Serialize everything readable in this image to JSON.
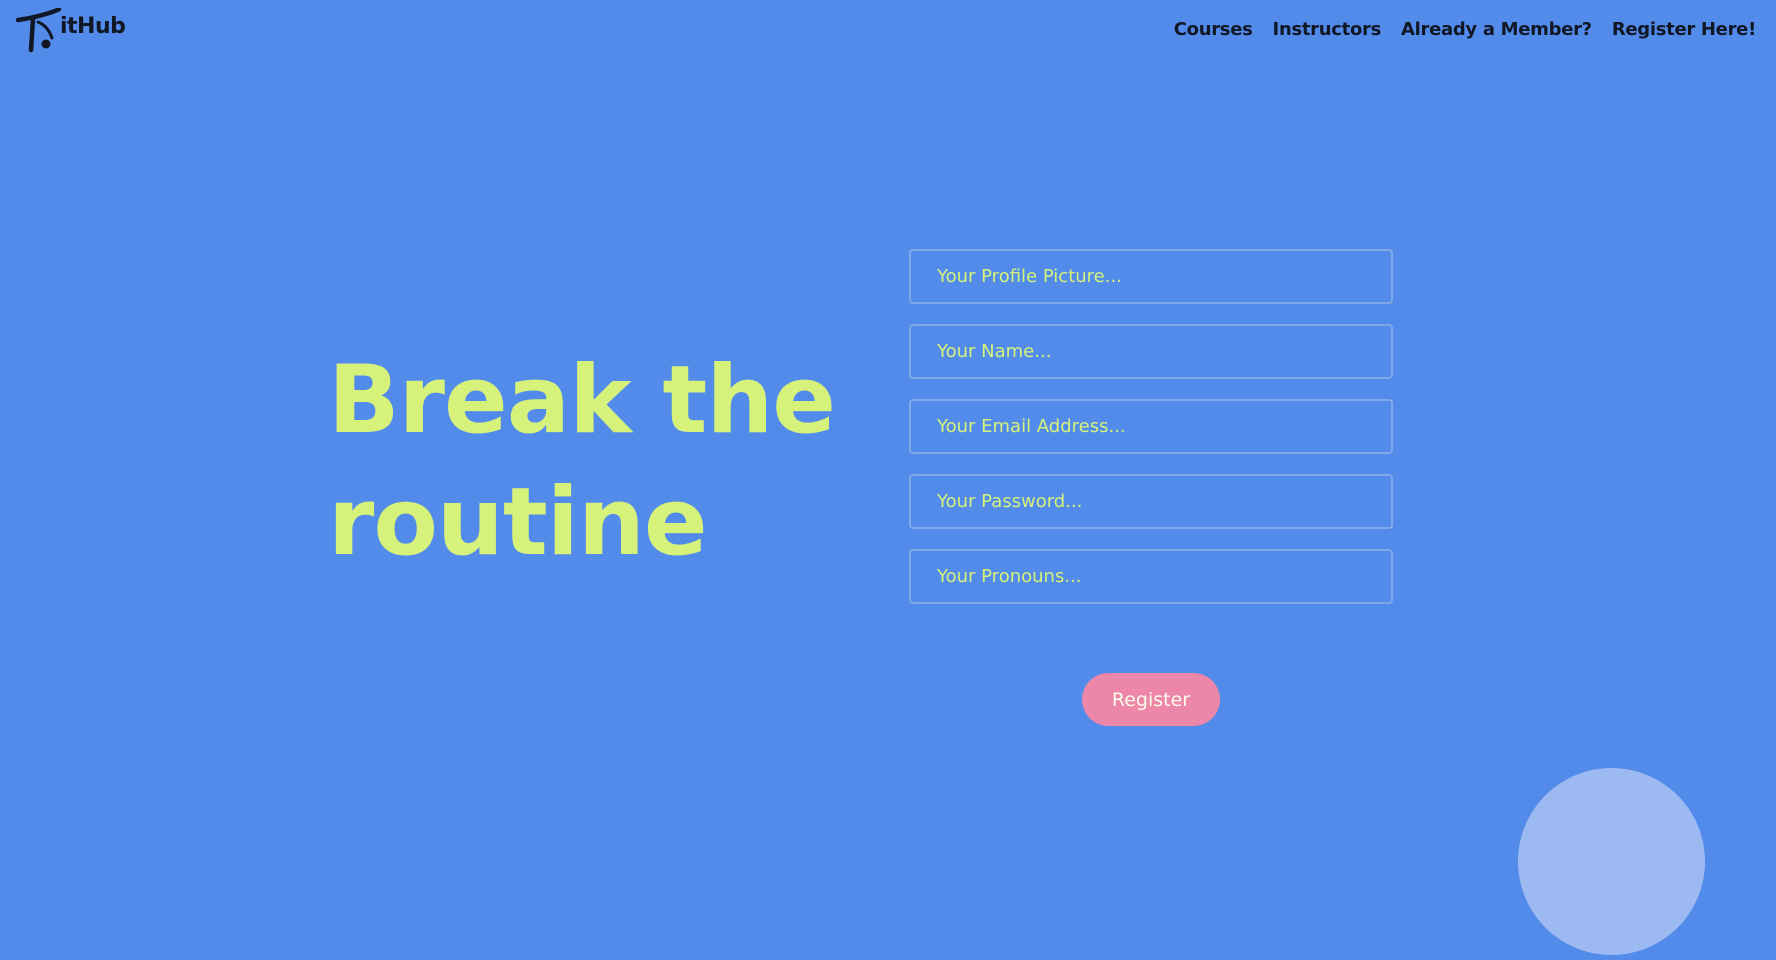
{
  "brand": {
    "name": "itHub",
    "logo_icon": "fithub-logo-icon"
  },
  "nav": {
    "items": [
      {
        "label": "Courses"
      },
      {
        "label": "Instructors"
      },
      {
        "label": "Already a Member?"
      },
      {
        "label": "Register Here!"
      }
    ]
  },
  "hero": {
    "line1": "Break the",
    "line2": "routine"
  },
  "form": {
    "fields": [
      {
        "placeholder": "Your Profile Picture...",
        "value": ""
      },
      {
        "placeholder": "Your Name...",
        "value": ""
      },
      {
        "placeholder": "Your Email Address...",
        "value": ""
      },
      {
        "placeholder": "Your Password...",
        "value": ""
      },
      {
        "placeholder": "Your Pronouns...",
        "value": ""
      }
    ],
    "submit_label": "Register"
  },
  "colors": {
    "background": "#528bea",
    "accent_text": "#d6f27b",
    "button": "#ec87a9",
    "nav_text": "#101725",
    "decor_circle": "#9db9f1"
  }
}
